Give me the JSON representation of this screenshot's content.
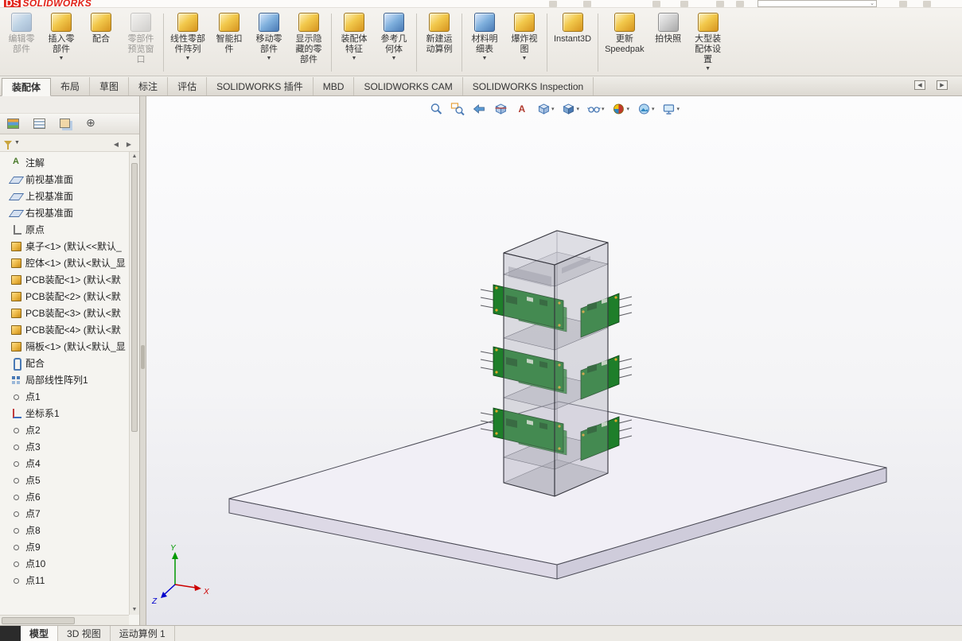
{
  "colors": {
    "logo-red": "#e2231a",
    "icon-gold": "#f2c94c",
    "icon-blue": "#7fb0dd",
    "pcb-green": "#1e7e2a"
  },
  "topbar": {
    "logo_prefix": "DS",
    "logo_text": "SOLIDWORKS"
  },
  "ribbon": {
    "buttons": [
      {
        "name": "edit-component",
        "label": "编辑零\n部件",
        "color": "blue",
        "disabled": true
      },
      {
        "name": "insert-components",
        "label": "插入零\n部件",
        "color": "gold",
        "dropdown": true
      },
      {
        "name": "mate",
        "label": "配合",
        "color": "gold"
      },
      {
        "name": "component-preview-window",
        "label": "零部件\n预览窗\n口",
        "color": "gray",
        "disabled": true,
        "sep_after": true
      },
      {
        "name": "linear-component-pattern",
        "label": "线性零部\n件阵列",
        "color": "gold",
        "dropdown": true
      },
      {
        "name": "smart-fasteners",
        "label": "智能扣\n件",
        "color": "gold"
      },
      {
        "name": "move-component",
        "label": "移动零\n部件",
        "color": "blue",
        "dropdown": true
      },
      {
        "name": "show-hidden-components",
        "label": "显示隐\n藏的零\n部件",
        "color": "gold",
        "sep_after": true
      },
      {
        "name": "assembly-features",
        "label": "装配体\n特征",
        "color": "gold",
        "dropdown": true
      },
      {
        "name": "reference-geometry",
        "label": "参考几\n何体",
        "color": "blue",
        "dropdown": true,
        "sep_after": true
      },
      {
        "name": "new-motion-study",
        "label": "新建运\n动算例",
        "color": "gold",
        "sep_after": true
      },
      {
        "name": "bill-of-materials",
        "label": "材料明\n细表",
        "color": "blue",
        "dropdown": true
      },
      {
        "name": "exploded-view",
        "label": "爆炸视\n图",
        "color": "gold",
        "dropdown": true,
        "sep_after": true
      },
      {
        "name": "instant3d",
        "label": "Instant3D",
        "color": "gold",
        "sep_after": true
      },
      {
        "name": "update-speedpak",
        "label": "更新\nSpeedpak",
        "color": "gold"
      },
      {
        "name": "take-snapshot",
        "label": "拍快照",
        "color": "gray"
      },
      {
        "name": "large-assembly-settings",
        "label": "大型装\n配体设\n置",
        "color": "gold",
        "dropdown": true
      }
    ]
  },
  "tabbar": {
    "tabs": [
      {
        "label": "装配体",
        "active": true
      },
      {
        "label": "布局"
      },
      {
        "label": "草图"
      },
      {
        "label": "标注"
      },
      {
        "label": "评估"
      },
      {
        "label": "SOLIDWORKS 插件"
      },
      {
        "label": "MBD"
      },
      {
        "label": "SOLIDWORKS CAM"
      },
      {
        "label": "SOLIDWORKS Inspection"
      }
    ]
  },
  "panel": {
    "tabs": [
      {
        "icon": "featuremanager"
      },
      {
        "icon": "propertymanager"
      },
      {
        "icon": "configurationmanager"
      },
      {
        "icon": "displaymanager"
      }
    ],
    "tree_items": [
      {
        "icon": "annotations",
        "label": "注解"
      },
      {
        "icon": "plane",
        "label": "前视基准面"
      },
      {
        "icon": "plane",
        "label": "上视基准面"
      },
      {
        "icon": "plane",
        "label": "右视基准面"
      },
      {
        "icon": "origin",
        "label": "原点"
      },
      {
        "icon": "component",
        "label": "桌子<1> (默认<<默认_"
      },
      {
        "icon": "component",
        "label": "腔体<1> (默认<默认_显"
      },
      {
        "icon": "component",
        "label": "PCB装配<1> (默认<默"
      },
      {
        "icon": "component",
        "label": "PCB装配<2> (默认<默"
      },
      {
        "icon": "component",
        "label": "PCB装配<3> (默认<默"
      },
      {
        "icon": "component",
        "label": "PCB装配<4> (默认<默"
      },
      {
        "icon": "component",
        "label": "隔板<1> (默认<默认_显"
      },
      {
        "icon": "mates",
        "label": "配合"
      },
      {
        "icon": "pattern",
        "label": "局部线性阵列1"
      },
      {
        "icon": "point",
        "label": "点1"
      },
      {
        "icon": "csys",
        "label": "坐标系1"
      },
      {
        "icon": "point",
        "label": "点2"
      },
      {
        "icon": "point",
        "label": "点3"
      },
      {
        "icon": "point",
        "label": "点4"
      },
      {
        "icon": "point",
        "label": "点5"
      },
      {
        "icon": "point",
        "label": "点6"
      },
      {
        "icon": "point",
        "label": "点7"
      },
      {
        "icon": "point",
        "label": "点8"
      },
      {
        "icon": "point",
        "label": "点9"
      },
      {
        "icon": "point",
        "label": "点10"
      },
      {
        "icon": "point",
        "label": "点11"
      }
    ]
  },
  "headsup": {
    "items": [
      {
        "icon": "zoom-fit"
      },
      {
        "icon": "zoom-area"
      },
      {
        "icon": "previous-view"
      },
      {
        "icon": "section-view"
      },
      {
        "icon": "dynamic-annotation"
      },
      {
        "icon": "view-orientation",
        "dropdown": true
      },
      {
        "icon": "display-style",
        "dropdown": true
      },
      {
        "icon": "hide-show-items",
        "dropdown": true
      },
      {
        "icon": "edit-appearance",
        "dropdown": true
      },
      {
        "icon": "apply-scene",
        "dropdown": true
      },
      {
        "icon": "view-settings",
        "dropdown": true
      }
    ]
  },
  "viewport": {
    "triad": {
      "x": "X",
      "y": "Y",
      "z": "Z"
    }
  },
  "statusbar": {
    "tabs": [
      {
        "label": "模型",
        "active": true
      },
      {
        "label": "3D 视图",
        "active": false
      },
      {
        "label": "运动算例 1",
        "active": false
      }
    ]
  }
}
